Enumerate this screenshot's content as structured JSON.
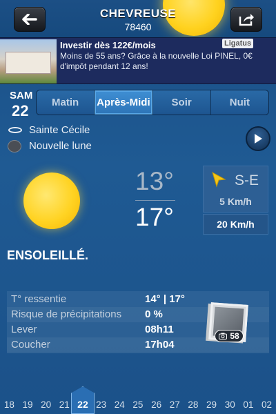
{
  "header": {
    "city": "CHEVREUSE",
    "zip": "78460",
    "back_icon": "arrow-left-icon",
    "share_icon": "share-icon"
  },
  "ad": {
    "title": "Investir dès 122€/mois",
    "text": "Moins de 55 ans? Grâce à la nouvelle Loi PINEL, 0€ d'impôt pendant 12 ans!",
    "brand": "Ligatus"
  },
  "day": {
    "name": "SAM",
    "number": "22"
  },
  "tabs": [
    {
      "label": "Matin",
      "active": false
    },
    {
      "label": "Après-Midi",
      "active": true
    },
    {
      "label": "Soir",
      "active": false
    },
    {
      "label": "Nuit",
      "active": false
    }
  ],
  "saint": "Sainte Cécile",
  "moon_phase": "Nouvelle lune",
  "weather": {
    "icon": "sun-icon",
    "temp_min": "13°",
    "temp_max": "17°",
    "wind_direction": "S-E",
    "wind_speed": "5 Km/h",
    "gust_speed": "20 Km/h",
    "condition": "ENSOLEILLÉ."
  },
  "details": [
    {
      "label": "T° ressentie",
      "value": "14° | 17°"
    },
    {
      "label": "Risque de précipitations",
      "value": "0 %"
    },
    {
      "label": "Lever",
      "value": "08h11"
    },
    {
      "label": "Coucher",
      "value": "17h04"
    }
  ],
  "photos": {
    "count": "58"
  },
  "day_strip": [
    "18",
    "19",
    "20",
    "21",
    "22",
    "23",
    "24",
    "25",
    "26",
    "27",
    "28",
    "29",
    "30",
    "01",
    "02"
  ],
  "selected_day": "22",
  "colors": {
    "background": "#1f5a93",
    "active_tab": "#2d74b7",
    "sun": "#ffd21f",
    "wind_arrow": "#f5c518"
  }
}
